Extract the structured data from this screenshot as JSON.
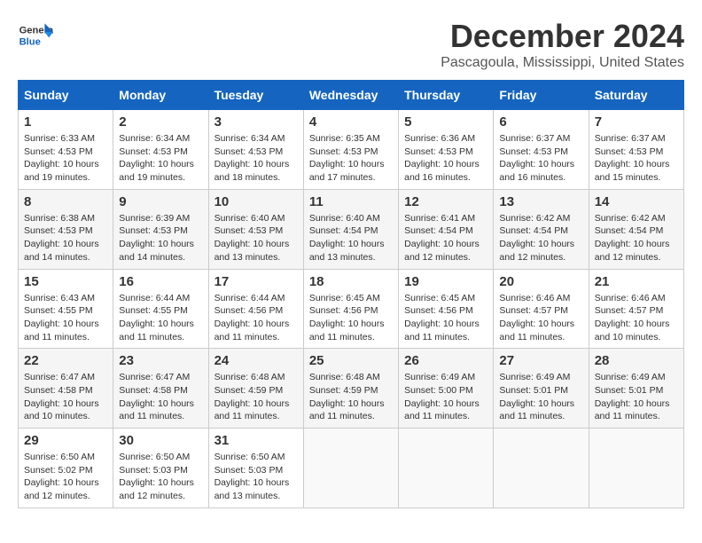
{
  "header": {
    "logo_line1": "General",
    "logo_line2": "Blue",
    "month_year": "December 2024",
    "location": "Pascagoula, Mississippi, United States"
  },
  "weekdays": [
    "Sunday",
    "Monday",
    "Tuesday",
    "Wednesday",
    "Thursday",
    "Friday",
    "Saturday"
  ],
  "weeks": [
    [
      {
        "day": "1",
        "info": "Sunrise: 6:33 AM\nSunset: 4:53 PM\nDaylight: 10 hours\nand 19 minutes."
      },
      {
        "day": "2",
        "info": "Sunrise: 6:34 AM\nSunset: 4:53 PM\nDaylight: 10 hours\nand 19 minutes."
      },
      {
        "day": "3",
        "info": "Sunrise: 6:34 AM\nSunset: 4:53 PM\nDaylight: 10 hours\nand 18 minutes."
      },
      {
        "day": "4",
        "info": "Sunrise: 6:35 AM\nSunset: 4:53 PM\nDaylight: 10 hours\nand 17 minutes."
      },
      {
        "day": "5",
        "info": "Sunrise: 6:36 AM\nSunset: 4:53 PM\nDaylight: 10 hours\nand 16 minutes."
      },
      {
        "day": "6",
        "info": "Sunrise: 6:37 AM\nSunset: 4:53 PM\nDaylight: 10 hours\nand 16 minutes."
      },
      {
        "day": "7",
        "info": "Sunrise: 6:37 AM\nSunset: 4:53 PM\nDaylight: 10 hours\nand 15 minutes."
      }
    ],
    [
      {
        "day": "8",
        "info": "Sunrise: 6:38 AM\nSunset: 4:53 PM\nDaylight: 10 hours\nand 14 minutes."
      },
      {
        "day": "9",
        "info": "Sunrise: 6:39 AM\nSunset: 4:53 PM\nDaylight: 10 hours\nand 14 minutes."
      },
      {
        "day": "10",
        "info": "Sunrise: 6:40 AM\nSunset: 4:53 PM\nDaylight: 10 hours\nand 13 minutes."
      },
      {
        "day": "11",
        "info": "Sunrise: 6:40 AM\nSunset: 4:54 PM\nDaylight: 10 hours\nand 13 minutes."
      },
      {
        "day": "12",
        "info": "Sunrise: 6:41 AM\nSunset: 4:54 PM\nDaylight: 10 hours\nand 12 minutes."
      },
      {
        "day": "13",
        "info": "Sunrise: 6:42 AM\nSunset: 4:54 PM\nDaylight: 10 hours\nand 12 minutes."
      },
      {
        "day": "14",
        "info": "Sunrise: 6:42 AM\nSunset: 4:54 PM\nDaylight: 10 hours\nand 12 minutes."
      }
    ],
    [
      {
        "day": "15",
        "info": "Sunrise: 6:43 AM\nSunset: 4:55 PM\nDaylight: 10 hours\nand 11 minutes."
      },
      {
        "day": "16",
        "info": "Sunrise: 6:44 AM\nSunset: 4:55 PM\nDaylight: 10 hours\nand 11 minutes."
      },
      {
        "day": "17",
        "info": "Sunrise: 6:44 AM\nSunset: 4:56 PM\nDaylight: 10 hours\nand 11 minutes."
      },
      {
        "day": "18",
        "info": "Sunrise: 6:45 AM\nSunset: 4:56 PM\nDaylight: 10 hours\nand 11 minutes."
      },
      {
        "day": "19",
        "info": "Sunrise: 6:45 AM\nSunset: 4:56 PM\nDaylight: 10 hours\nand 11 minutes."
      },
      {
        "day": "20",
        "info": "Sunrise: 6:46 AM\nSunset: 4:57 PM\nDaylight: 10 hours\nand 11 minutes."
      },
      {
        "day": "21",
        "info": "Sunrise: 6:46 AM\nSunset: 4:57 PM\nDaylight: 10 hours\nand 10 minutes."
      }
    ],
    [
      {
        "day": "22",
        "info": "Sunrise: 6:47 AM\nSunset: 4:58 PM\nDaylight: 10 hours\nand 10 minutes."
      },
      {
        "day": "23",
        "info": "Sunrise: 6:47 AM\nSunset: 4:58 PM\nDaylight: 10 hours\nand 11 minutes."
      },
      {
        "day": "24",
        "info": "Sunrise: 6:48 AM\nSunset: 4:59 PM\nDaylight: 10 hours\nand 11 minutes."
      },
      {
        "day": "25",
        "info": "Sunrise: 6:48 AM\nSunset: 4:59 PM\nDaylight: 10 hours\nand 11 minutes."
      },
      {
        "day": "26",
        "info": "Sunrise: 6:49 AM\nSunset: 5:00 PM\nDaylight: 10 hours\nand 11 minutes."
      },
      {
        "day": "27",
        "info": "Sunrise: 6:49 AM\nSunset: 5:01 PM\nDaylight: 10 hours\nand 11 minutes."
      },
      {
        "day": "28",
        "info": "Sunrise: 6:49 AM\nSunset: 5:01 PM\nDaylight: 10 hours\nand 11 minutes."
      }
    ],
    [
      {
        "day": "29",
        "info": "Sunrise: 6:50 AM\nSunset: 5:02 PM\nDaylight: 10 hours\nand 12 minutes."
      },
      {
        "day": "30",
        "info": "Sunrise: 6:50 AM\nSunset: 5:03 PM\nDaylight: 10 hours\nand 12 minutes."
      },
      {
        "day": "31",
        "info": "Sunrise: 6:50 AM\nSunset: 5:03 PM\nDaylight: 10 hours\nand 13 minutes."
      },
      null,
      null,
      null,
      null
    ]
  ]
}
